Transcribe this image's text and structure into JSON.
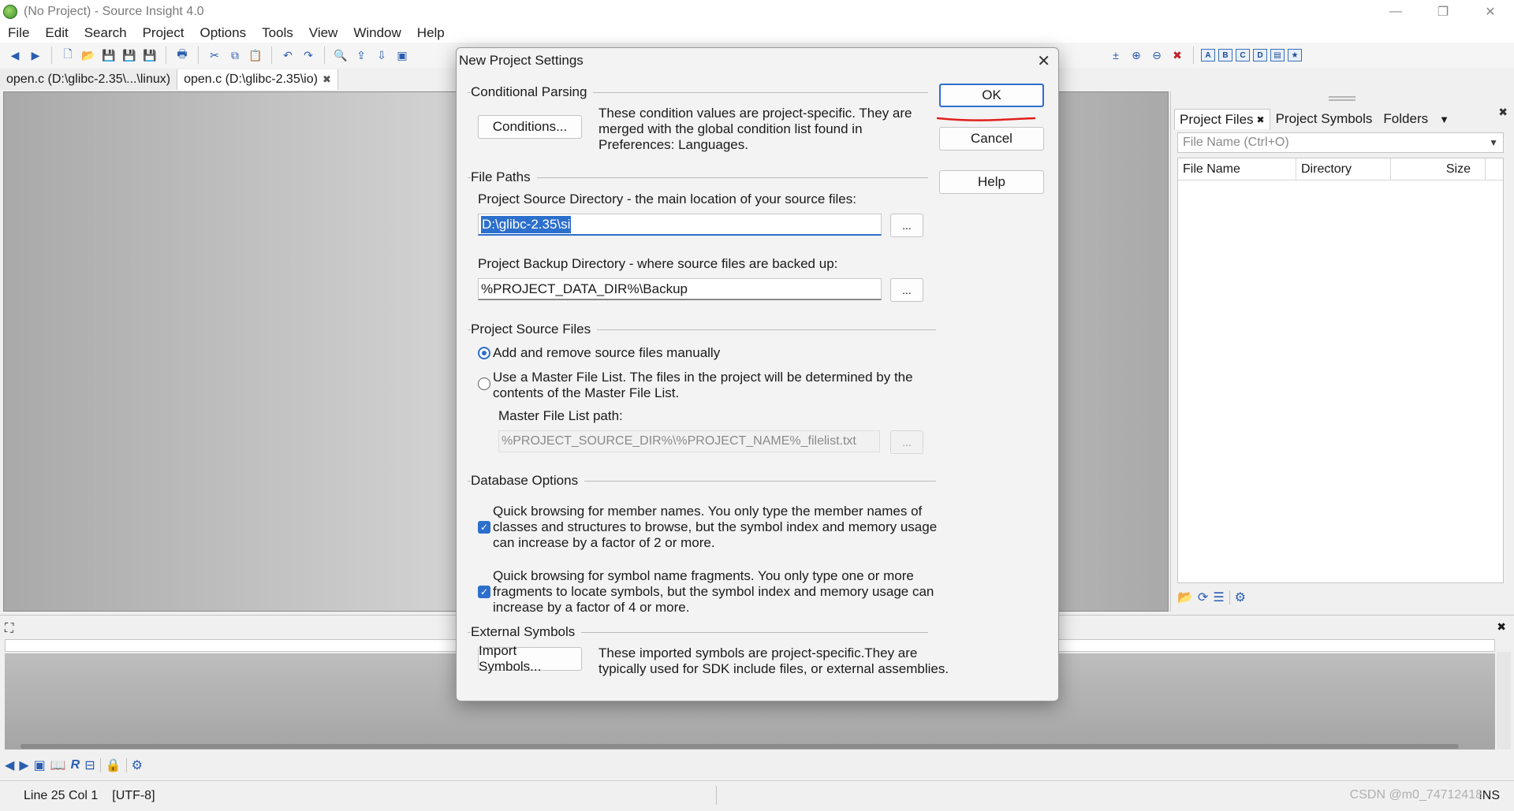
{
  "window": {
    "title": "(No Project) - Source Insight 4.0",
    "controls": [
      "—",
      "❐",
      "✕"
    ]
  },
  "menu": [
    "File",
    "Edit",
    "Search",
    "Project",
    "Options",
    "Tools",
    "View",
    "Window",
    "Help"
  ],
  "file_tabs": [
    {
      "label": "open.c (D:\\glibc-2.35\\...\\linux)"
    },
    {
      "label": "open.c (D:\\glibc-2.35\\io)",
      "close": "✖"
    }
  ],
  "right_panel": {
    "tabs": [
      "Project Files",
      "Project Symbols",
      "Folders"
    ],
    "close_glyph": "✖",
    "chevron": "▼",
    "filter_placeholder": "File Name (Ctrl+O)",
    "columns": [
      "File Name",
      "Directory",
      "Size"
    ]
  },
  "dialog": {
    "title": "New Project Settings",
    "close": "✕",
    "buttons": {
      "ok": "OK",
      "cancel": "Cancel",
      "help": "Help"
    },
    "conditional": {
      "label": "Conditional Parsing",
      "button": "Conditions...",
      "desc": [
        "These condition values are project-specific.  They are",
        "merged with the global condition list found in",
        "Preferences: Languages."
      ]
    },
    "paths": {
      "label": "File Paths",
      "source_label": "Project Source Directory - the main location of your source files:",
      "source_value": "D:\\glibc-2.35\\si",
      "backup_label": "Project Backup Directory - where source files are backed up:",
      "backup_value": "%PROJECT_DATA_DIR%\\Backup",
      "browse": "..."
    },
    "source_files": {
      "label": "Project Source Files",
      "manual": "Add and remove source files manually",
      "master_line1": "Use a Master File List. The files in the project will be determined by the",
      "master_line2": "contents of the Master File List.",
      "master_path_label": "Master File List path:",
      "master_path_value": "%PROJECT_SOURCE_DIR%\\%PROJECT_NAME%_filelist.txt"
    },
    "database": {
      "label": "Database Options",
      "opt1": [
        "Quick browsing for member names.  You only type the member names of",
        "classes and structures to browse, but the symbol index and memory usage",
        "can increase by a factor of 2 or more."
      ],
      "opt2": [
        "Quick browsing for symbol name fragments.  You only type one or more",
        "fragments to locate symbols, but the symbol index and memory usage can",
        "increase by a factor of 4 or more."
      ]
    },
    "external": {
      "label": "External Symbols",
      "button": "Import Symbols...",
      "desc": [
        "These imported symbols are project-specific.They are",
        "typically used for SDK include files, or external assemblies."
      ]
    }
  },
  "status": {
    "position": "Line 25  Col 1",
    "encoding": "[UTF-8]",
    "mode": "INS"
  },
  "watermark": "CSDN @m0_74712418",
  "colors": {
    "accent": "#2c6fcc",
    "annotation": "#e0201c"
  }
}
